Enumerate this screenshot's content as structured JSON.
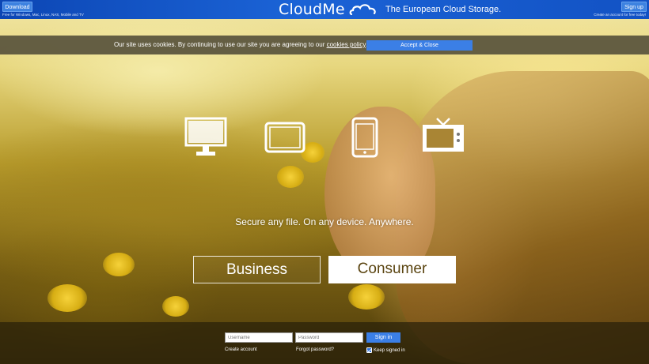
{
  "header": {
    "download_label": "Download",
    "download_note": "Free for Windows, Mac, Linux, NAS, Mobile and TV",
    "logo_text": "CloudMe",
    "tagline": "The European Cloud Storage.",
    "signup_label": "Sign up",
    "signup_note": "Create an account for free today!"
  },
  "cookie": {
    "text_before": "Our site uses cookies. By continuing to use our site you are agreeing to our ",
    "link_text": "cookies policy",
    "text_after": ".",
    "accept_label": "Accept & Close"
  },
  "hero": {
    "devices": [
      "monitor-icon",
      "tablet-icon",
      "phone-icon",
      "tv-icon"
    ],
    "tagline": "Secure any file. On any device. Anywhere.",
    "business_label": "Business",
    "consumer_label": "Consumer"
  },
  "login": {
    "username_placeholder": "Username",
    "password_placeholder": "Password",
    "signin_label": "Sign in",
    "create_account": "Create account",
    "forgot_password": "Forgot password?",
    "keep_signed_in": "Keep signed in",
    "keep_signed_in_checked": true
  },
  "colors": {
    "topbar": "#1b63d6",
    "button_blue": "#3b7fe6",
    "cookie_bar": "#58523c"
  }
}
